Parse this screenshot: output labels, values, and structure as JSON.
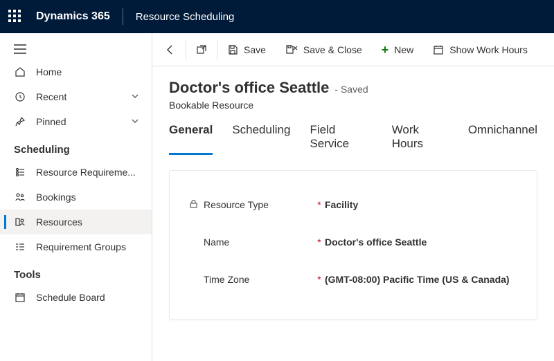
{
  "topbar": {
    "brand": "Dynamics 365",
    "module": "Resource Scheduling"
  },
  "sidebar": {
    "top": [
      {
        "label": "Home"
      },
      {
        "label": "Recent"
      },
      {
        "label": "Pinned"
      }
    ],
    "section1_title": "Scheduling",
    "section1": [
      {
        "label": "Resource Requireme..."
      },
      {
        "label": "Bookings"
      },
      {
        "label": "Resources"
      },
      {
        "label": "Requirement Groups"
      }
    ],
    "section2_title": "Tools",
    "section2": [
      {
        "label": "Schedule Board"
      }
    ]
  },
  "cmdbar": {
    "save": "Save",
    "saveclose": "Save & Close",
    "new": "New",
    "workhours": "Show Work Hours"
  },
  "page": {
    "title": "Doctor's office Seattle",
    "status": "- Saved",
    "entity": "Bookable Resource",
    "tabs": [
      "General",
      "Scheduling",
      "Field Service",
      "Work Hours",
      "Omnichannel"
    ],
    "active_tab": 0,
    "fields": {
      "resource_type": {
        "label": "Resource Type",
        "value": "Facility",
        "locked": true,
        "required": true
      },
      "name": {
        "label": "Name",
        "value": "Doctor's office Seattle",
        "required": true
      },
      "time_zone": {
        "label": "Time Zone",
        "value": "(GMT-08:00) Pacific Time (US & Canada)",
        "required": true
      }
    }
  }
}
